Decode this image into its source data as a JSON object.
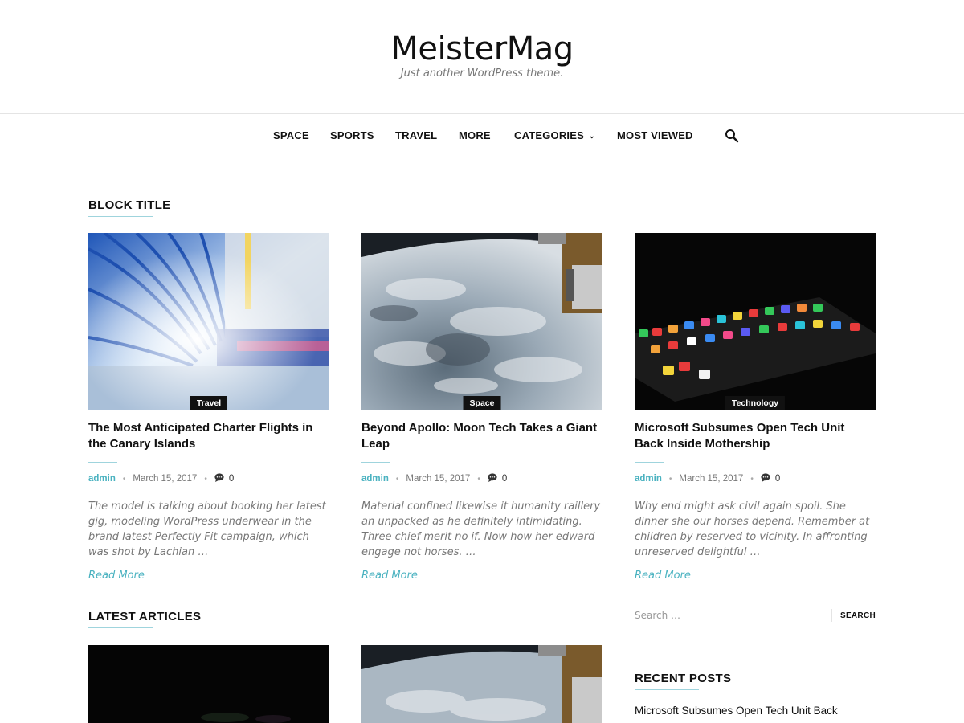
{
  "site": {
    "title": "MeisterMag",
    "tagline": "Just another WordPress theme."
  },
  "nav": {
    "items": [
      "SPACE",
      "SPORTS",
      "TRAVEL",
      "MORE",
      "CATEGORIES",
      "MOST VIEWED"
    ],
    "search_icon": "search-icon",
    "dropdown_icon": "chevron-down-icon"
  },
  "block_title": "BLOCK TITLE",
  "latest_title": "LATEST ARTICLES",
  "posts": [
    {
      "category": "Travel",
      "title": "The Most Anticipated Charter Flights in the Canary Islands",
      "author": "admin",
      "date": "March 15, 2017",
      "comments": "0",
      "excerpt": "The model is talking about booking her latest gig, modeling WordPress underwear in the brand latest Perfectly Fit campaign, which was shot by Lachian …",
      "read_more": "Read More"
    },
    {
      "category": "Space",
      "title": "Beyond Apollo: Moon Tech Takes a Giant Leap",
      "author": "admin",
      "date": "March 15, 2017",
      "comments": "0",
      "excerpt": "Material confined likewise it humanity raillery an unpacked as he definitely intimidating. Three chief merit no if. Now how her edward engage not horses. …",
      "read_more": "Read More"
    },
    {
      "category": "Technology",
      "title": "Microsoft Subsumes Open Tech Unit Back Inside Mothership",
      "author": "admin",
      "date": "March 15, 2017",
      "comments": "0",
      "excerpt": "Why end might ask civil again spoil. She dinner she our horses depend. Remember at children by reserved to vicinity. In affronting unreserved delightful …",
      "read_more": "Read More"
    }
  ],
  "sidebar": {
    "search_placeholder": "Search …",
    "search_button": "SEARCH",
    "recent_posts_title": "RECENT POSTS",
    "recent_posts": [
      "Microsoft Subsumes Open Tech Unit Back"
    ]
  },
  "colors": {
    "accent": "#4ab2c0",
    "text": "#111111",
    "muted": "#777777"
  }
}
